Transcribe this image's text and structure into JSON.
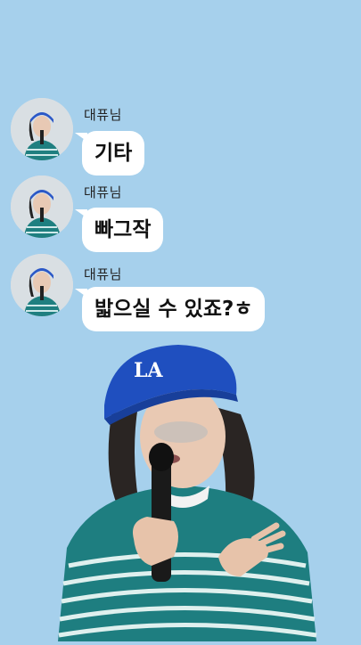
{
  "messages": [
    {
      "sender": "대퓨님",
      "text": "기타"
    },
    {
      "sender": "대퓨님",
      "text": "빠그작"
    },
    {
      "sender": "대퓨님",
      "text": "밟으실 수 있죠?ㅎ"
    }
  ],
  "photo": {
    "cap_text": "LA"
  },
  "colors": {
    "background": "#a6d0ec",
    "bubble": "#ffffff",
    "cap": "#1f4fbf",
    "shirt": "#1e7e80"
  }
}
